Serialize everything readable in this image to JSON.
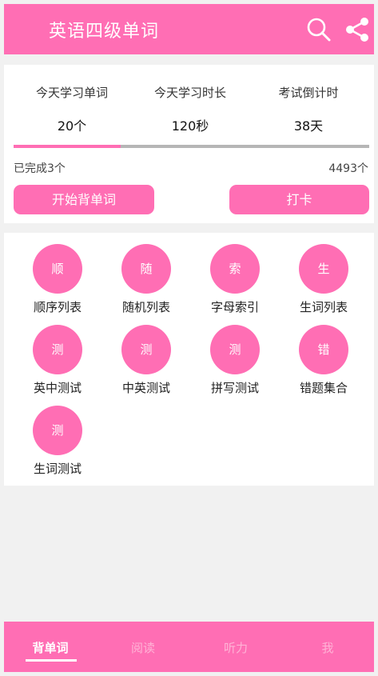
{
  "header": {
    "title": "英语四级单词",
    "search_icon": "search-icon",
    "share_icon": "share-icon"
  },
  "stats": {
    "items": [
      {
        "label": "今天学习单词",
        "value": "20个"
      },
      {
        "label": "今天学习时长",
        "value": "120秒"
      },
      {
        "label": "考试倒计时",
        "value": "38天"
      }
    ],
    "progress_fraction": 0.3,
    "completed": "已完成3个",
    "total": "4493个",
    "start_button": "开始背单词",
    "checkin_button": "打卡"
  },
  "grid": {
    "items": [
      {
        "glyph": "顺",
        "label": "顺序列表"
      },
      {
        "glyph": "随",
        "label": "随机列表"
      },
      {
        "glyph": "索",
        "label": "字母索引"
      },
      {
        "glyph": "生",
        "label": "生词列表"
      },
      {
        "glyph": "测",
        "label": "英中测试"
      },
      {
        "glyph": "测",
        "label": "中英测试"
      },
      {
        "glyph": "测",
        "label": "拼写测试"
      },
      {
        "glyph": "错",
        "label": "错题集合"
      },
      {
        "glyph": "测",
        "label": "生词测试"
      }
    ]
  },
  "tabs": [
    {
      "label": "背单词",
      "active": true
    },
    {
      "label": "阅读",
      "active": false
    },
    {
      "label": "听力",
      "active": false
    },
    {
      "label": "我",
      "active": false
    }
  ],
  "colors": {
    "accent": "#ff6eb4",
    "track": "#b6b6b6",
    "background": "#f1f1f1"
  }
}
